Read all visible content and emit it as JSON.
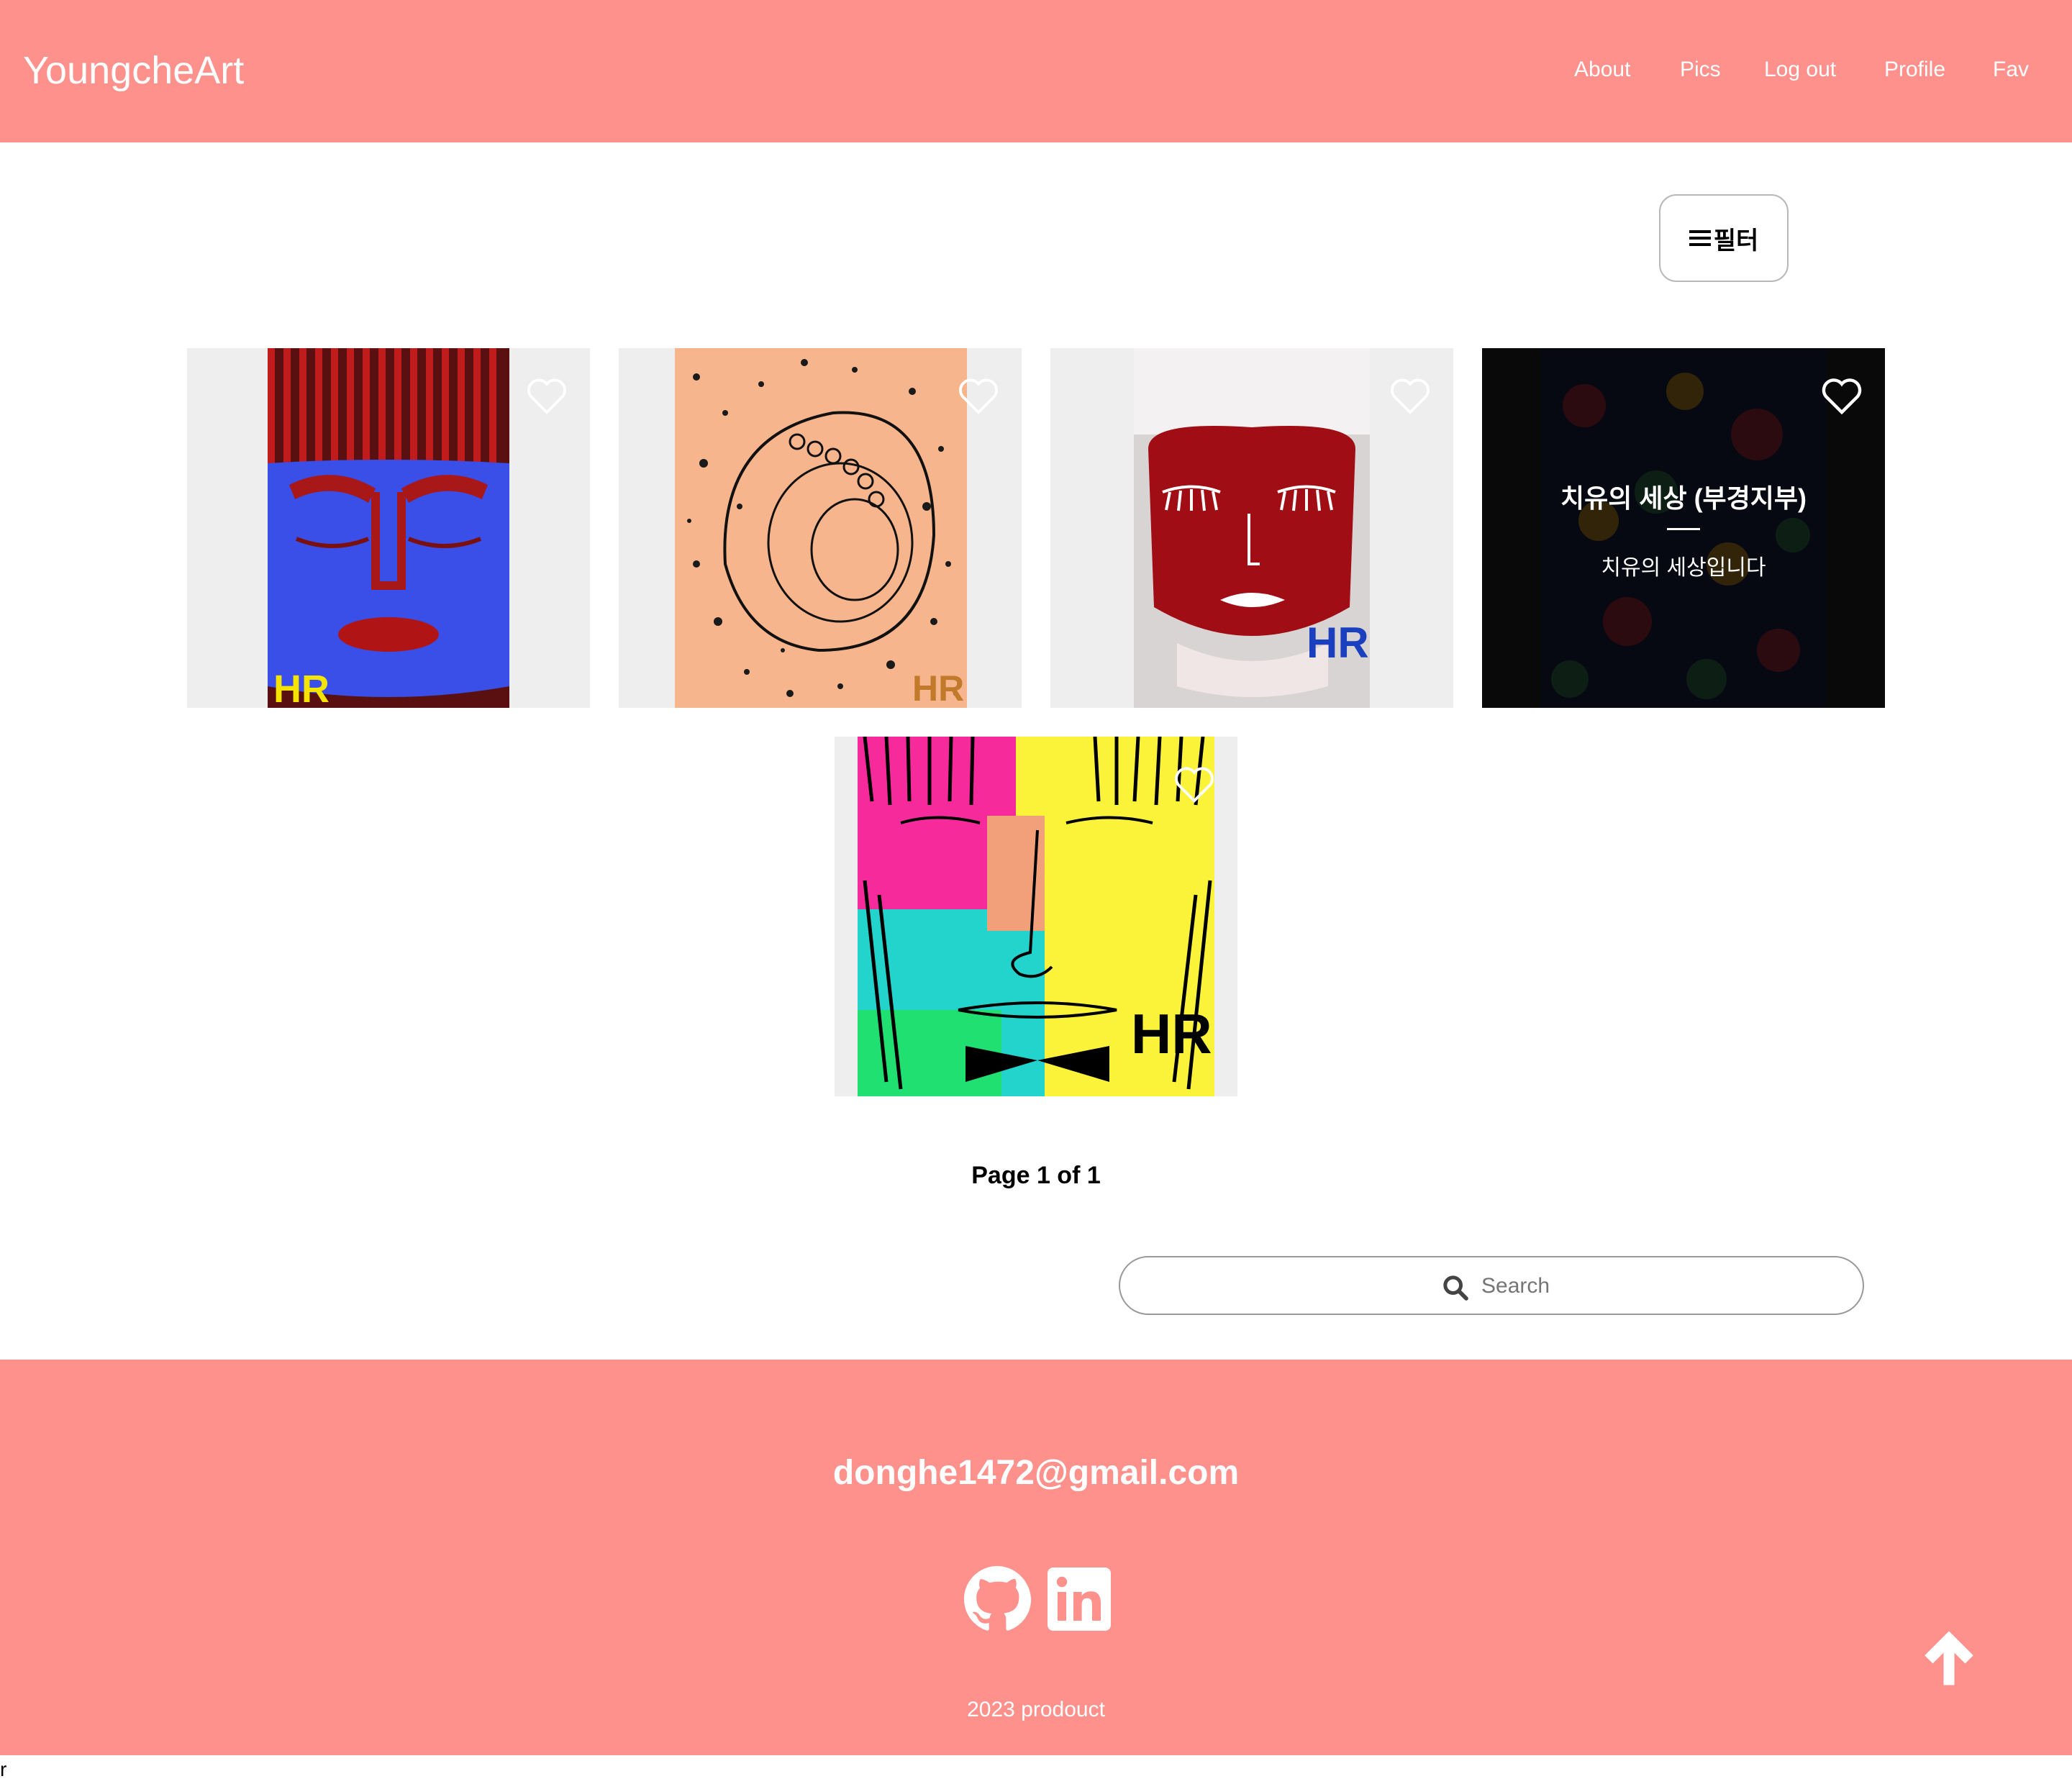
{
  "header": {
    "brand": "YoungcheArt",
    "links": [
      "About",
      "Pics",
      "Log out",
      "Profile",
      "Fav"
    ]
  },
  "filter": {
    "label": "필터",
    "icon": "menu-icon"
  },
  "gallery": {
    "items": [
      {
        "name": "blue-face-painting",
        "favorited": false
      },
      {
        "name": "peach-abstract-painting",
        "favorited": false
      },
      {
        "name": "red-face-painting",
        "favorited": false
      },
      {
        "name": "dark-floral-painting",
        "favorited": false,
        "title": "치유의 세상 (부경지부)",
        "description": "치유의 세상입니다"
      },
      {
        "name": "neon-face-painting",
        "favorited": false
      }
    ]
  },
  "pagination": {
    "text": "Page 1 of 1"
  },
  "search": {
    "placeholder": "Search",
    "icon": "search-icon"
  },
  "footer": {
    "email": "donghe1472@gmail.com",
    "social": [
      "github-icon",
      "linkedin-icon"
    ],
    "copyright": "2023 prodouct",
    "scroll_top_icon": "arrow-up-icon"
  },
  "stray_text": "r",
  "colors": {
    "brand": "#fe918c",
    "card_bg": "#eeeeee"
  }
}
